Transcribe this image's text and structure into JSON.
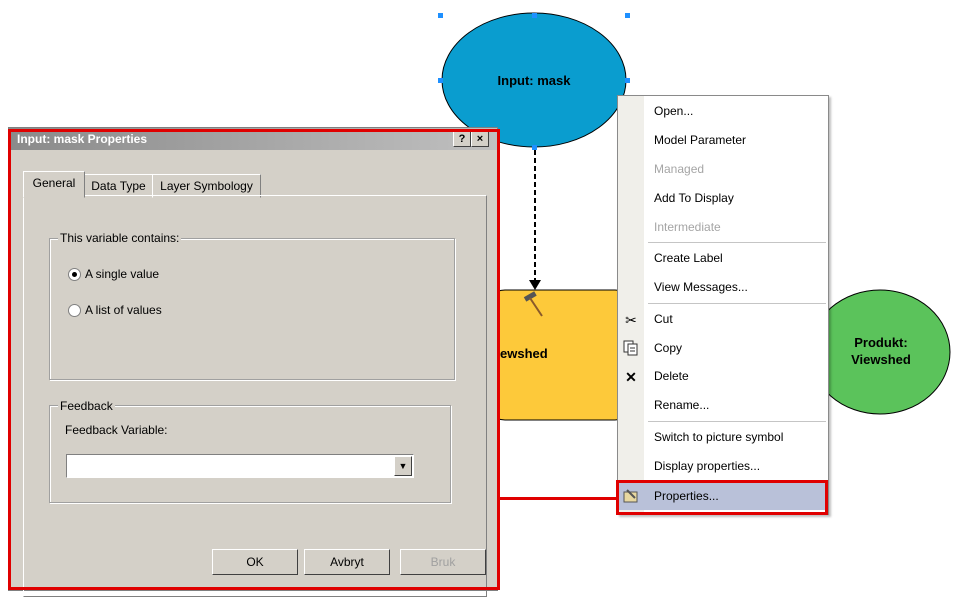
{
  "model": {
    "input_node": "Input: mask",
    "tool_node": "Viewshed",
    "output_node_line1": "Produkt:",
    "output_node_line2": "Viewshed",
    "colors": {
      "input": "#0a9dcf",
      "tool": "#fdc93a",
      "output": "#5bc35b",
      "highlight": "#e00000"
    }
  },
  "context_menu": {
    "items": [
      {
        "label": "Open...",
        "enabled": true,
        "icon": ""
      },
      {
        "label": "Model Parameter",
        "enabled": true,
        "icon": ""
      },
      {
        "label": "Managed",
        "enabled": false,
        "icon": ""
      },
      {
        "label": "Add To Display",
        "enabled": true,
        "icon": ""
      },
      {
        "label": "Intermediate",
        "enabled": false,
        "icon": ""
      },
      {
        "label": "Create Label",
        "enabled": true,
        "icon": ""
      },
      {
        "label": "View Messages...",
        "enabled": true,
        "icon": ""
      },
      {
        "label": "Cut",
        "enabled": true,
        "icon": "scissors-icon"
      },
      {
        "label": "Copy",
        "enabled": true,
        "icon": "copy-icon"
      },
      {
        "label": "Delete",
        "enabled": true,
        "icon": "delete-x-icon"
      },
      {
        "label": "Rename...",
        "enabled": true,
        "icon": ""
      },
      {
        "label": "Switch to picture symbol",
        "enabled": true,
        "icon": ""
      },
      {
        "label": "Display properties...",
        "enabled": true,
        "icon": ""
      },
      {
        "label": "Properties...",
        "enabled": true,
        "icon": "properties-icon"
      }
    ]
  },
  "dialog": {
    "title": "Input: mask Properties",
    "help_button": "?",
    "close_button": "×",
    "tabs": [
      "General",
      "Data Type",
      "Layer Symbology"
    ],
    "active_tab": "General",
    "variable_group_title": "This variable contains:",
    "radio_single": "A single value",
    "radio_list": "A list of values",
    "selected_radio": "A single value",
    "feedback_group_title": "Feedback",
    "feedback_label": "Feedback Variable:",
    "feedback_value": "",
    "ok": "OK",
    "cancel": "Avbryt",
    "apply": "Bruk"
  }
}
